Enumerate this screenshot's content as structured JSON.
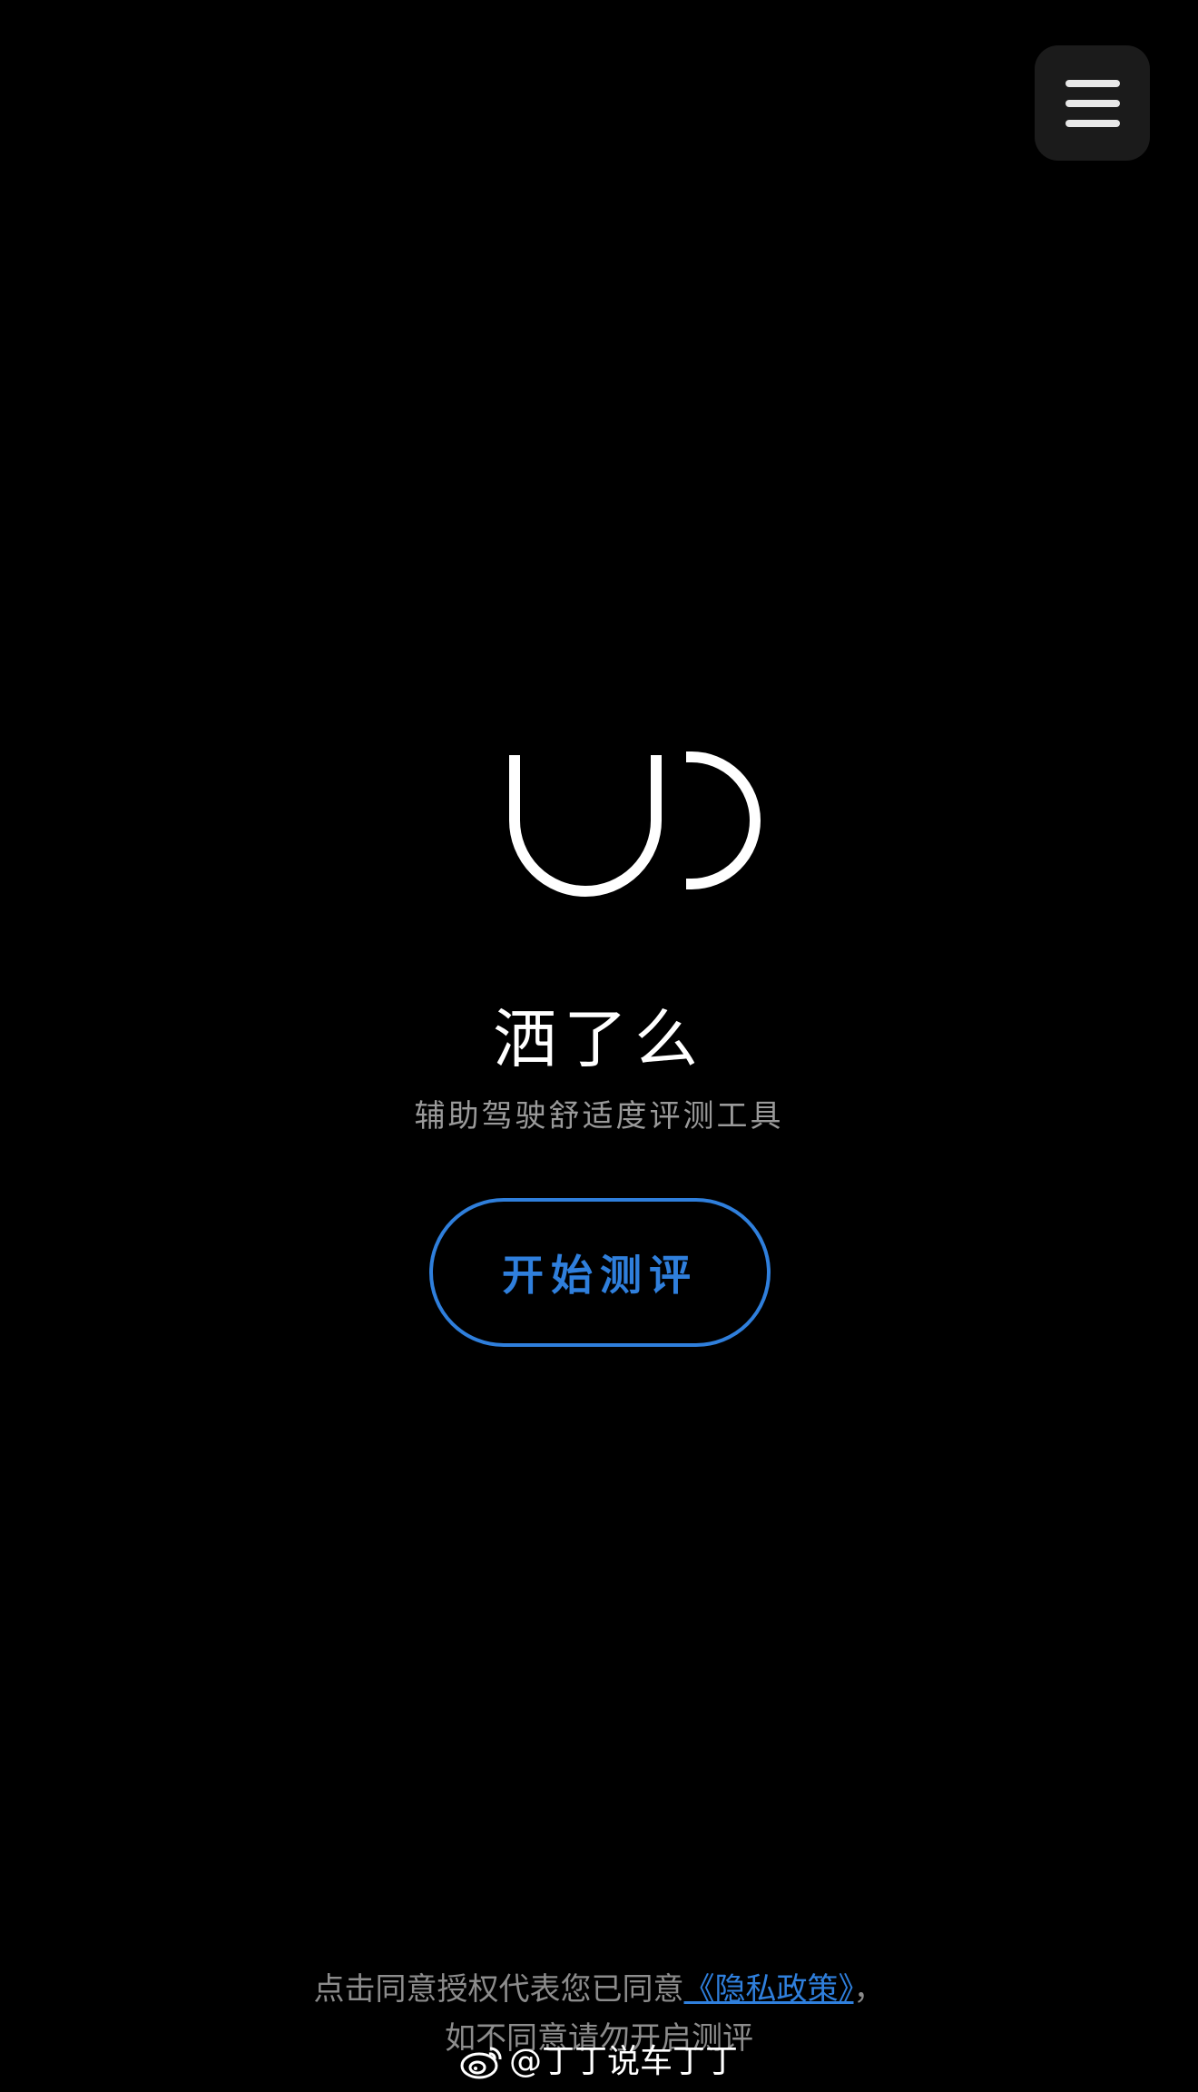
{
  "header": {
    "menu_icon": "hamburger-menu-icon"
  },
  "logo": {
    "icon": "ud-logo-icon"
  },
  "main": {
    "title": "洒了么",
    "subtitle": "辅助驾驶舒适度评测工具",
    "start_button_label": "开始测评"
  },
  "footer": {
    "consent_prefix": "点击同意授权代表您已同意",
    "policy_link": "《隐私政策》",
    "consent_suffix": "，",
    "consent_line2": "如不同意请勿开启测评"
  },
  "watermark": {
    "text": "@丁丁说车丁丁",
    "icon": "weibo-icon"
  },
  "colors": {
    "background": "#000000",
    "accent": "#2f7fdc",
    "menu_button_bg": "#1b1b1b",
    "muted_text": "#8c8c8c"
  }
}
